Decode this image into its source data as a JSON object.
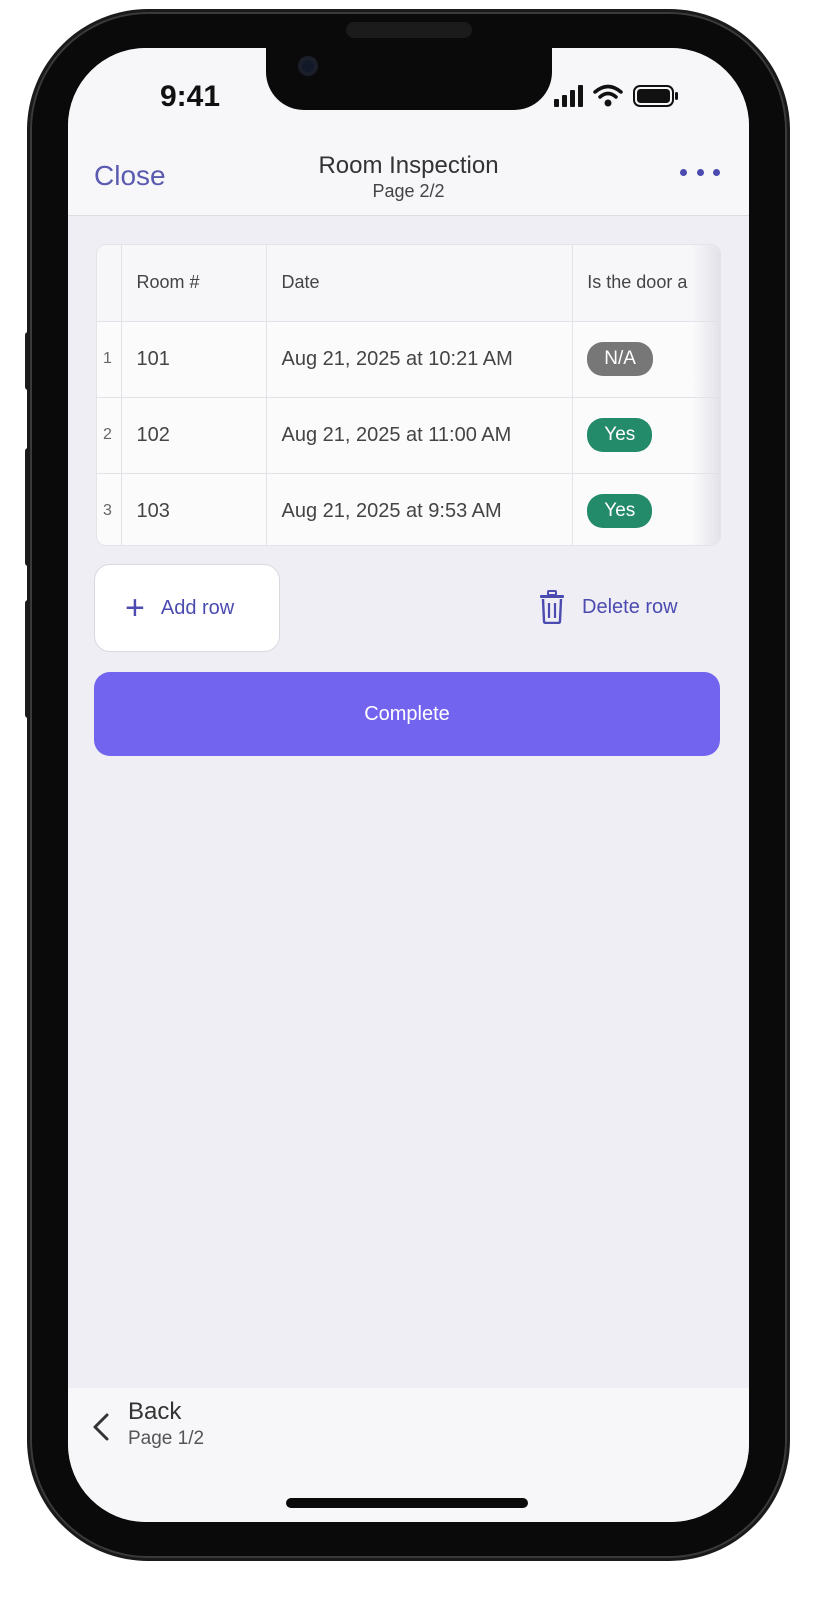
{
  "status_bar": {
    "time": "9:41"
  },
  "header": {
    "close_label": "Close",
    "title": "Room Inspection",
    "subtitle": "Page 2/2"
  },
  "table": {
    "columns": [
      "Room #",
      "Date",
      "Is the door a"
    ],
    "rows": [
      {
        "index": "1",
        "room": "101",
        "date": "Aug 21, 2025 at 10:21 AM",
        "door": "N/A",
        "door_status": "na"
      },
      {
        "index": "2",
        "room": "102",
        "date": "Aug 21, 2025 at 11:00 AM",
        "door": "Yes",
        "door_status": "yes"
      },
      {
        "index": "3",
        "room": "103",
        "date": "Aug 21, 2025 at 9:53 AM",
        "door": "Yes",
        "door_status": "yes"
      }
    ]
  },
  "actions": {
    "add_row_label": "Add row",
    "delete_row_label": "Delete row",
    "complete_label": "Complete"
  },
  "footer": {
    "back_label": "Back",
    "back_sub": "Page 1/2"
  },
  "colors": {
    "accent": "#4b4bb0",
    "primary_button": "#7364ef",
    "status_yes": "#238a6a",
    "status_na": "#777777"
  },
  "icons": [
    "signal-icon",
    "wifi-icon",
    "battery-icon",
    "more-icon",
    "plus-icon",
    "trash-icon",
    "chevron-left-icon"
  ]
}
